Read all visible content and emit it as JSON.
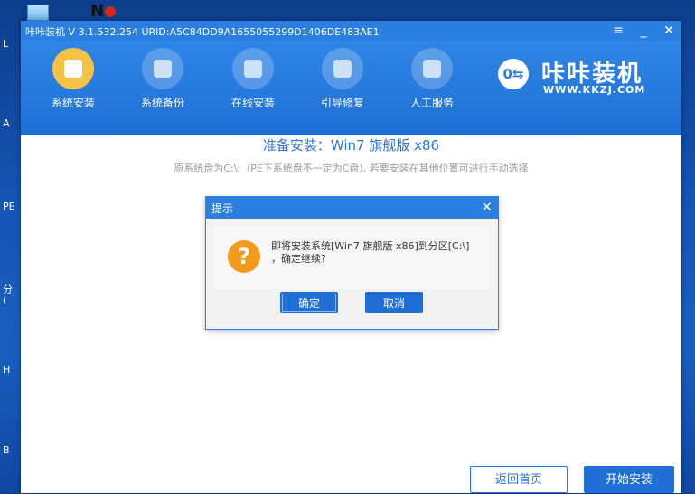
{
  "desktop": {
    "labels": [
      "L",
      "A",
      "PE",
      "分",
      "(",
      "H",
      "B"
    ]
  },
  "window": {
    "title": "咔咔装机 V 3.1.532.254 URID:A5C84DD9A1655055299D1406DE483AE1",
    "menu_glyph": "≡",
    "minimize_glyph": "_",
    "close_glyph": "✕"
  },
  "tabs": [
    {
      "label": "系统安装",
      "active": true,
      "icon": "system-install-icon"
    },
    {
      "label": "系统备份",
      "active": false,
      "icon": "backup-icon"
    },
    {
      "label": "在线安装",
      "active": false,
      "icon": "download-icon"
    },
    {
      "label": "引导修复",
      "active": false,
      "icon": "toolbox-icon"
    },
    {
      "label": "人工服务",
      "active": false,
      "icon": "chat-icon"
    }
  ],
  "logo": {
    "mark": "0⇆",
    "title": "咔咔装机",
    "url": "WWW.KKZJ.COM"
  },
  "content": {
    "title": "准备安装：Win7 旗舰版 x86",
    "note": "原系统盘为C:\\:（PE下系统盘不一定为C盘), 若要安装在其他位置可进行手动选择",
    "back_button": "返回首页",
    "start_button": "开始安装"
  },
  "dialog": {
    "title": "提示",
    "close_glyph": "✕",
    "icon_glyph": "?",
    "message_line1": "即将安装系统[Win7 旗舰版 x86]到分区[C:\\]",
    "message_line2": "，确定继续?",
    "ok_button": "确定",
    "cancel_button": "取消"
  },
  "colors": {
    "accent": "#2b7fe0",
    "active_tab": "#f6c244",
    "warning": "#f29a1c"
  }
}
